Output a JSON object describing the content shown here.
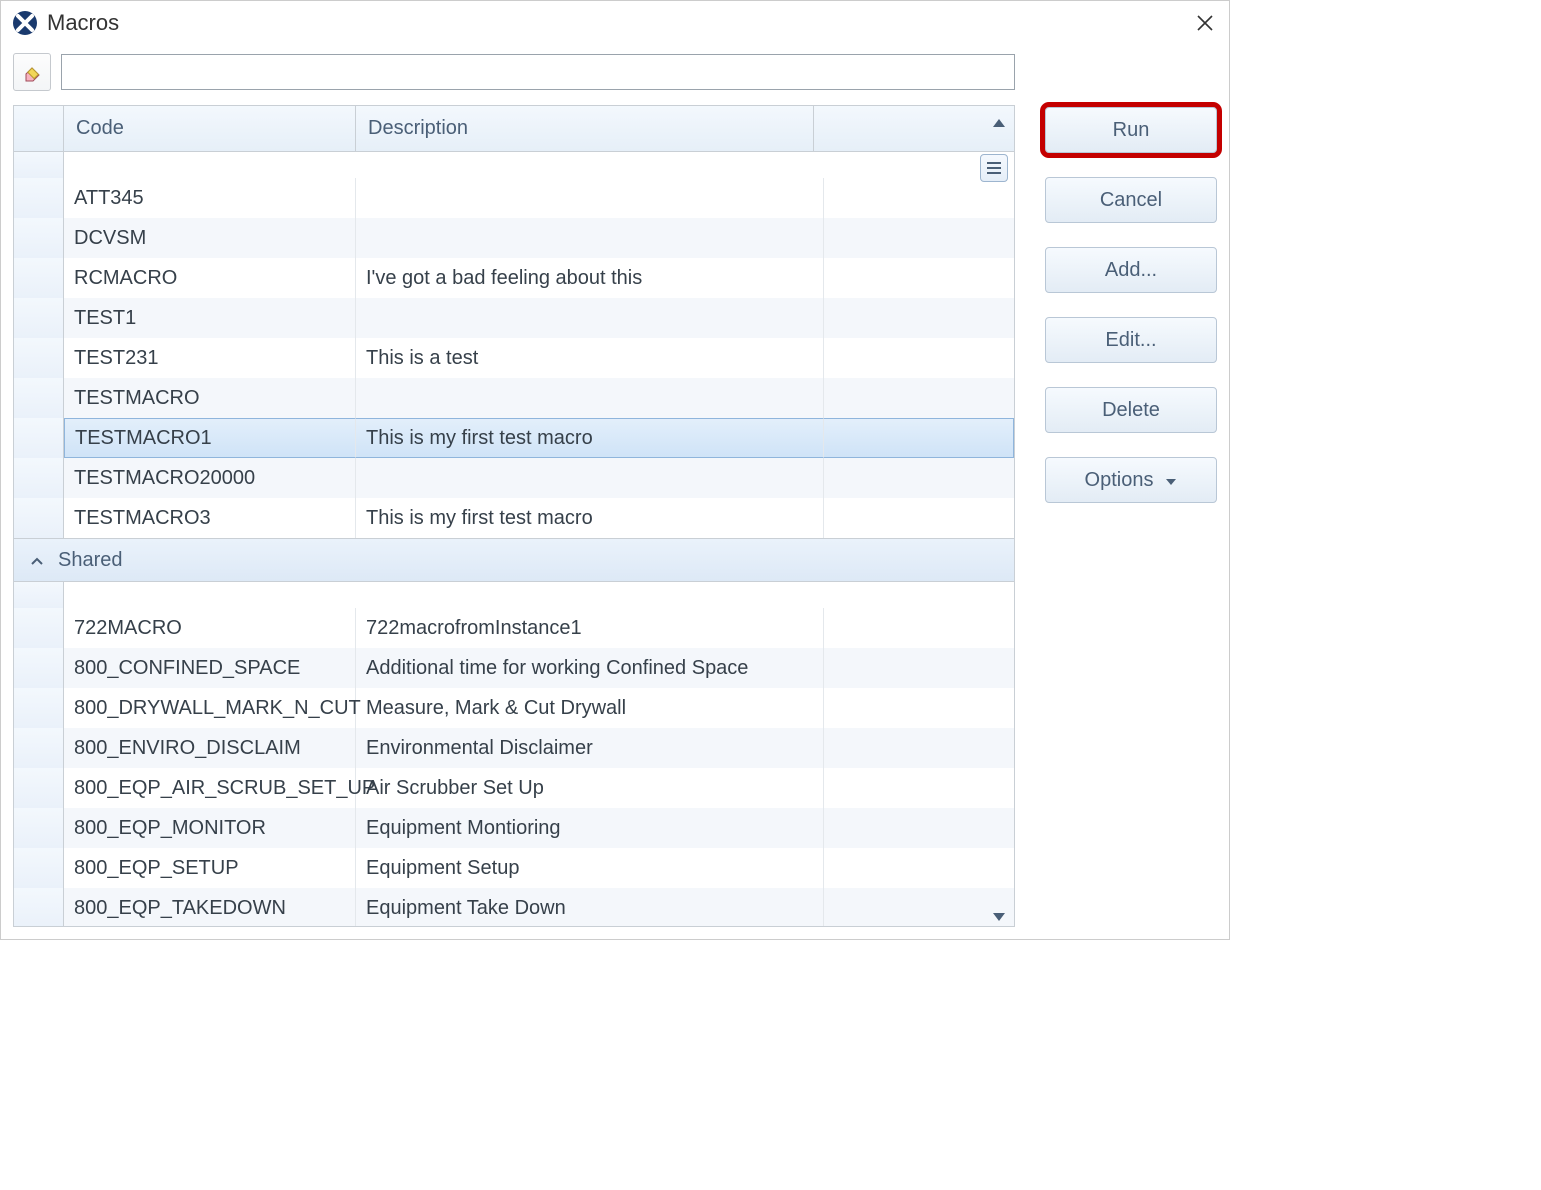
{
  "window": {
    "title": "Macros"
  },
  "search": {
    "value": ""
  },
  "columns": {
    "code": "Code",
    "description": "Description"
  },
  "group1_rows": [
    {
      "code": "ATT345",
      "desc": ""
    },
    {
      "code": "DCVSM",
      "desc": ""
    },
    {
      "code": "RCMACRO",
      "desc": "I've got a bad feeling about this"
    },
    {
      "code": "TEST1",
      "desc": ""
    },
    {
      "code": "TEST231",
      "desc": "This is a test"
    },
    {
      "code": "TESTMACRO",
      "desc": ""
    },
    {
      "code": "TESTMACRO1",
      "desc": "This is my first test macro",
      "selected": true
    },
    {
      "code": "TESTMACRO20000",
      "desc": ""
    },
    {
      "code": "TESTMACRO3",
      "desc": "This is my first test macro"
    }
  ],
  "group2": {
    "label": "Shared",
    "rows": [
      {
        "code": "722MACRO",
        "desc": "722macrofromInstance1"
      },
      {
        "code": "800_CONFINED_SPACE",
        "desc": "Additional time for working Confined Space"
      },
      {
        "code": "800_DRYWALL_MARK_N_CUT",
        "desc": "Measure, Mark & Cut Drywall"
      },
      {
        "code": "800_ENVIRO_DISCLAIM",
        "desc": "Environmental Disclaimer"
      },
      {
        "code": "800_EQP_AIR_SCRUB_SET_UP",
        "desc": "Air Scrubber Set Up"
      },
      {
        "code": "800_EQP_MONITOR",
        "desc": "Equipment Montioring"
      },
      {
        "code": "800_EQP_SETUP",
        "desc": "Equipment Setup"
      },
      {
        "code": "800_EQP_TAKEDOWN",
        "desc": "Equipment Take Down"
      }
    ]
  },
  "buttons": {
    "run": "Run",
    "cancel": "Cancel",
    "add": "Add...",
    "edit": "Edit...",
    "delete": "Delete",
    "options": "Options"
  }
}
